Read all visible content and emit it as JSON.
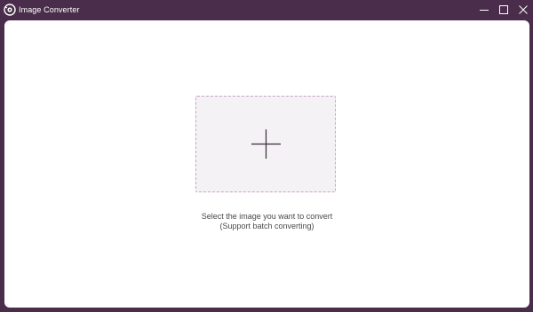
{
  "window": {
    "title": "Image Converter",
    "icon": "eye-camera-app-icon",
    "controls": {
      "minimize": "minimize-icon",
      "maximize": "maximize-icon",
      "close": "close-icon"
    }
  },
  "dropzone": {
    "icon": "plus-icon",
    "line1": "Select the image you want to convert",
    "line2": "(Support batch converting)"
  },
  "colors": {
    "frame": "#4a2d4a",
    "content_bg": "#ffffff",
    "dropzone_bg": "#f4f2f5",
    "dropzone_border": "#c9a3c7",
    "plus": "#3a2a3a"
  }
}
